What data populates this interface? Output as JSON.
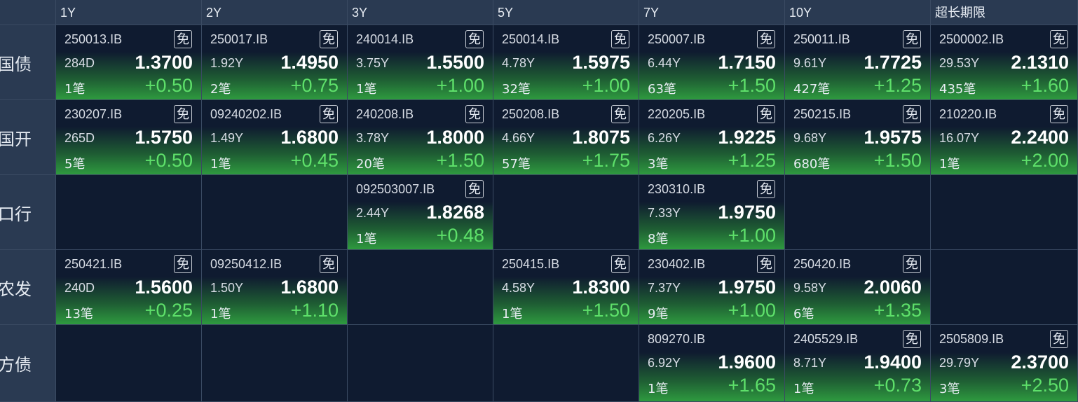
{
  "header": {
    "tenors": [
      "1Y",
      "2Y",
      "3Y",
      "5Y",
      "7Y",
      "10Y",
      "超长期限"
    ]
  },
  "rows": [
    {
      "label": "国债",
      "cells": [
        {
          "code": "250013.IB",
          "badge": "免",
          "tenor": "284D",
          "rate": "1.3700",
          "count": "1笔",
          "change": "+0.50"
        },
        {
          "code": "250017.IB",
          "badge": "免",
          "tenor": "1.92Y",
          "rate": "1.4950",
          "count": "2笔",
          "change": "+0.75"
        },
        {
          "code": "240014.IB",
          "badge": "免",
          "tenor": "3.75Y",
          "rate": "1.5500",
          "count": "1笔",
          "change": "+1.00"
        },
        {
          "code": "250014.IB",
          "badge": "免",
          "tenor": "4.78Y",
          "rate": "1.5975",
          "count": "32笔",
          "change": "+1.00"
        },
        {
          "code": "250007.IB",
          "badge": "免",
          "tenor": "6.44Y",
          "rate": "1.7150",
          "count": "63笔",
          "change": "+1.50"
        },
        {
          "code": "250011.IB",
          "badge": "免",
          "tenor": "9.61Y",
          "rate": "1.7725",
          "count": "427笔",
          "change": "+1.25"
        },
        {
          "code": "2500002.IB",
          "badge": "免",
          "tenor": "29.53Y",
          "rate": "2.1310",
          "count": "435笔",
          "change": "+1.60"
        }
      ]
    },
    {
      "label": "国开",
      "cells": [
        {
          "code": "230207.IB",
          "badge": "免",
          "tenor": "265D",
          "rate": "1.5750",
          "count": "5笔",
          "change": "+0.50"
        },
        {
          "code": "09240202.IB",
          "badge": "免",
          "tenor": "1.49Y",
          "rate": "1.6800",
          "count": "1笔",
          "change": "+0.45"
        },
        {
          "code": "240208.IB",
          "badge": "免",
          "tenor": "3.78Y",
          "rate": "1.8000",
          "count": "20笔",
          "change": "+1.50"
        },
        {
          "code": "250208.IB",
          "badge": "免",
          "tenor": "4.66Y",
          "rate": "1.8075",
          "count": "57笔",
          "change": "+1.75"
        },
        {
          "code": "220205.IB",
          "badge": "免",
          "tenor": "6.26Y",
          "rate": "1.9225",
          "count": "3笔",
          "change": "+1.25"
        },
        {
          "code": "250215.IB",
          "badge": "免",
          "tenor": "9.68Y",
          "rate": "1.9575",
          "count": "680笔",
          "change": "+1.50"
        },
        {
          "code": "210220.IB",
          "badge": "免",
          "tenor": "16.07Y",
          "rate": "2.2400",
          "count": "1笔",
          "change": "+2.00"
        }
      ]
    },
    {
      "label": "进出口行",
      "cells": [
        null,
        null,
        {
          "code": "092503007.IB",
          "badge": "免",
          "tenor": "2.44Y",
          "rate": "1.8268",
          "count": "1笔",
          "change": "+0.48"
        },
        null,
        {
          "code": "230310.IB",
          "badge": "免",
          "tenor": "7.33Y",
          "rate": "1.9750",
          "count": "8笔",
          "change": "+1.00"
        },
        null,
        null
      ]
    },
    {
      "label": "农发",
      "cells": [
        {
          "code": "250421.IB",
          "badge": "免",
          "tenor": "240D",
          "rate": "1.5600",
          "count": "13笔",
          "change": "+0.25"
        },
        {
          "code": "09250412.IB",
          "badge": "免",
          "tenor": "1.50Y",
          "rate": "1.6800",
          "count": "1笔",
          "change": "+1.10"
        },
        null,
        {
          "code": "250415.IB",
          "badge": "免",
          "tenor": "4.58Y",
          "rate": "1.8300",
          "count": "1笔",
          "change": "+1.50"
        },
        {
          "code": "230402.IB",
          "badge": "免",
          "tenor": "7.37Y",
          "rate": "1.9750",
          "count": "9笔",
          "change": "+1.00"
        },
        {
          "code": "250420.IB",
          "badge": "免",
          "tenor": "9.58Y",
          "rate": "2.0060",
          "count": "6笔",
          "change": "+1.35"
        },
        null
      ]
    },
    {
      "label": "地方债",
      "cells": [
        null,
        null,
        null,
        null,
        {
          "code": "809270.IB",
          "badge": "",
          "tenor": "6.92Y",
          "rate": "1.9600",
          "count": "1笔",
          "change": "+1.65"
        },
        {
          "code": "2405529.IB",
          "badge": "免",
          "tenor": "8.71Y",
          "rate": "1.9400",
          "count": "1笔",
          "change": "+0.73"
        },
        {
          "code": "2505809.IB",
          "badge": "免",
          "tenor": "29.79Y",
          "rate": "2.3700",
          "count": "3笔",
          "change": "+2.50"
        }
      ]
    }
  ]
}
